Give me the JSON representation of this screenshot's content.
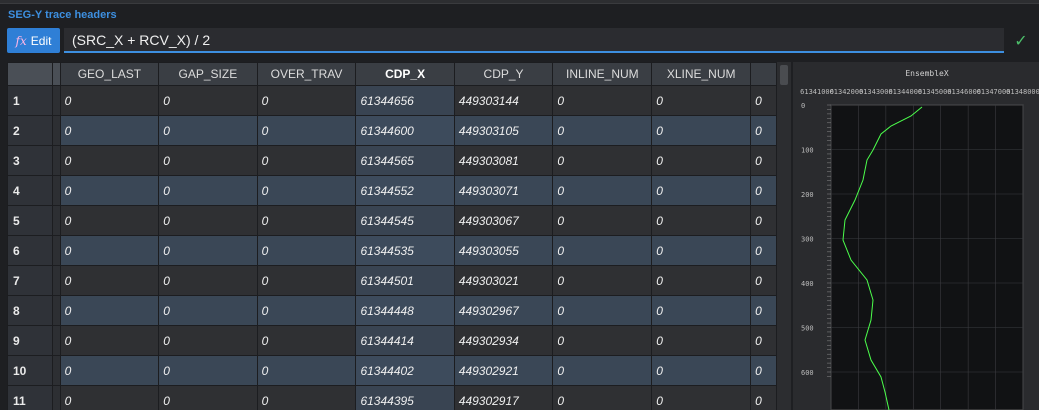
{
  "panel": {
    "title": "SEG-Y trace headers"
  },
  "toolbar": {
    "edit_label": "Edit",
    "fx_glyph": "fx",
    "formula": "(SRC_X + RCV_X) / 2",
    "confirm_icon": "check-icon"
  },
  "table": {
    "columns": [
      "GEO_LAST",
      "GAP_SIZE",
      "OVER_TRAV",
      "CDP_X",
      "CDP_Y",
      "INLINE_NUM",
      "XLINE_NUM"
    ],
    "rows": [
      {
        "n": "1",
        "v": [
          "0",
          "0",
          "0",
          "61344656",
          "449303144",
          "0",
          "0",
          "0"
        ]
      },
      {
        "n": "2",
        "v": [
          "0",
          "0",
          "0",
          "61344600",
          "449303105",
          "0",
          "0",
          "0"
        ]
      },
      {
        "n": "3",
        "v": [
          "0",
          "0",
          "0",
          "61344565",
          "449303081",
          "0",
          "0",
          "0"
        ]
      },
      {
        "n": "4",
        "v": [
          "0",
          "0",
          "0",
          "61344552",
          "449303071",
          "0",
          "0",
          "0"
        ]
      },
      {
        "n": "5",
        "v": [
          "0",
          "0",
          "0",
          "61344545",
          "449303067",
          "0",
          "0",
          "0"
        ]
      },
      {
        "n": "6",
        "v": [
          "0",
          "0",
          "0",
          "61344535",
          "449303055",
          "0",
          "0",
          "0"
        ]
      },
      {
        "n": "7",
        "v": [
          "0",
          "0",
          "0",
          "61344501",
          "449303021",
          "0",
          "0",
          "0"
        ]
      },
      {
        "n": "8",
        "v": [
          "0",
          "0",
          "0",
          "61344448",
          "449302967",
          "0",
          "0",
          "0"
        ]
      },
      {
        "n": "9",
        "v": [
          "0",
          "0",
          "0",
          "61344414",
          "449302934",
          "0",
          "0",
          "0"
        ]
      },
      {
        "n": "10",
        "v": [
          "0",
          "0",
          "0",
          "61344402",
          "449302921",
          "0",
          "0",
          "0"
        ]
      },
      {
        "n": "11",
        "v": [
          "0",
          "0",
          "0",
          "61344395",
          "449302917",
          "0",
          "0",
          "0"
        ]
      }
    ]
  },
  "plot": {
    "title": "EnsembleX",
    "x_ticks": [
      "61341000",
      "61342000",
      "61343000",
      "61344000",
      "61345000",
      "61346000",
      "61347000",
      "61348000"
    ],
    "y_ticks": [
      "0",
      "100",
      "200",
      "300",
      "400",
      "500",
      "600"
    ],
    "line_color": "#4cff4c"
  }
}
